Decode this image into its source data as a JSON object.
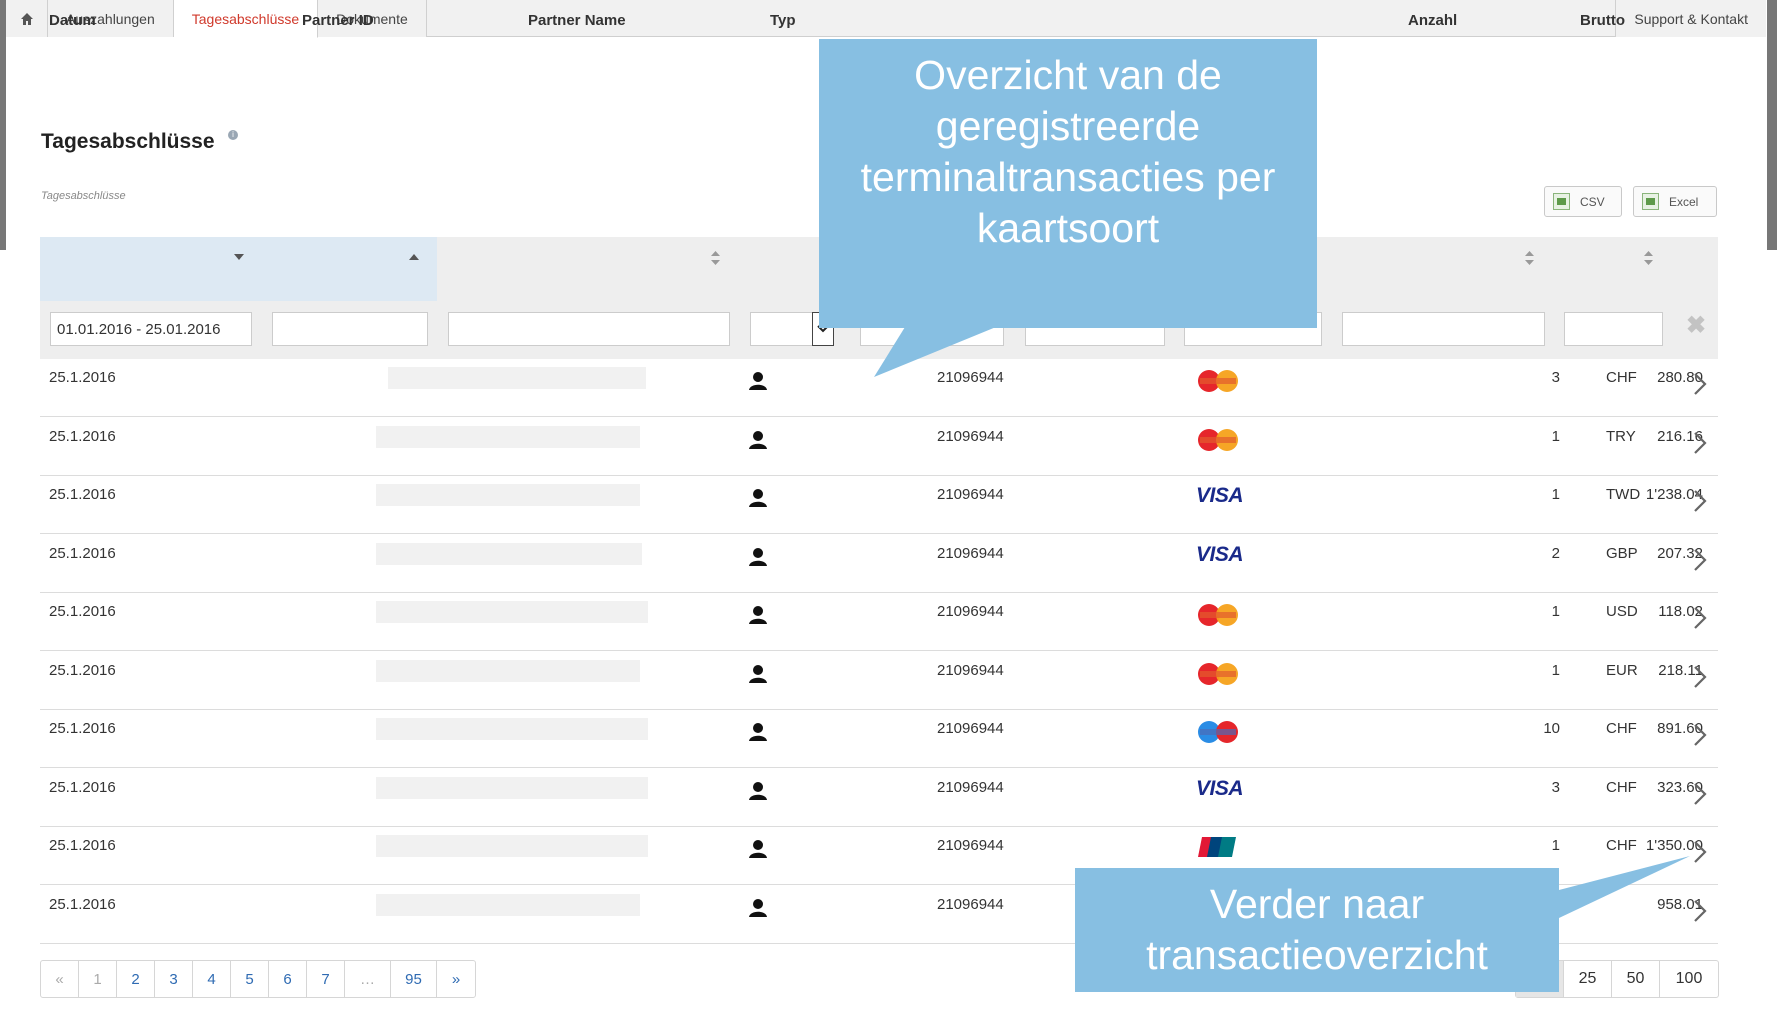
{
  "nav": {
    "home_icon": "home-icon",
    "tabs": [
      {
        "label": "Auszahlungen",
        "active": false
      },
      {
        "label": "Tagesabschlüsse",
        "active": true
      },
      {
        "label": "Dokumente",
        "active": false
      }
    ],
    "support": "Support & Kontakt"
  },
  "page": {
    "title": "Tagesabschlüsse",
    "info_icon": "info-icon",
    "subtitle": "Tagesabschlüsse"
  },
  "export": {
    "csv": "CSV",
    "excel": "Excel"
  },
  "table": {
    "headers": {
      "datum": "Datum",
      "partner_id": "Partner ID",
      "partner_name": "Partner Name",
      "typ": "Typ",
      "anzahl": "Anzahl",
      "brutto": "Brutto"
    },
    "filters": {
      "datum": "01.01.2016 - 25.01.2016"
    },
    "rows": [
      {
        "date": "25.1.2016",
        "terminal": "21096944",
        "card": "mastercard",
        "count": "3",
        "currency": "CHF",
        "amount": "280.80"
      },
      {
        "date": "25.1.2016",
        "terminal": "21096944",
        "card": "mastercard",
        "count": "1",
        "currency": "TRY",
        "amount": "216.16"
      },
      {
        "date": "25.1.2016",
        "terminal": "21096944",
        "card": "visa",
        "count": "1",
        "currency": "TWD",
        "amount": "1'238.04"
      },
      {
        "date": "25.1.2016",
        "terminal": "21096944",
        "card": "visa",
        "count": "2",
        "currency": "GBP",
        "amount": "207.32"
      },
      {
        "date": "25.1.2016",
        "terminal": "21096944",
        "card": "mastercard",
        "count": "1",
        "currency": "USD",
        "amount": "118.02"
      },
      {
        "date": "25.1.2016",
        "terminal": "21096944",
        "card": "mastercard",
        "count": "1",
        "currency": "EUR",
        "amount": "218.11"
      },
      {
        "date": "25.1.2016",
        "terminal": "21096944",
        "card": "maestro",
        "count": "10",
        "currency": "CHF",
        "amount": "891.60"
      },
      {
        "date": "25.1.2016",
        "terminal": "21096944",
        "card": "visa",
        "count": "3",
        "currency": "CHF",
        "amount": "323.60"
      },
      {
        "date": "25.1.2016",
        "terminal": "21096944",
        "card": "unionpay",
        "count": "1",
        "currency": "CHF",
        "amount": "1'350.00"
      },
      {
        "date": "25.1.2016",
        "terminal": "21096944",
        "card": "unknown",
        "count": "",
        "currency": "",
        "amount": "958.01"
      }
    ],
    "visa_text": "VISA"
  },
  "pagination": {
    "prev": "«",
    "pages": [
      "1",
      "2",
      "3",
      "4",
      "5",
      "6",
      "7",
      "…",
      "95"
    ],
    "next": "»",
    "sizes": [
      "",
      "25",
      "50",
      "100"
    ]
  },
  "callouts": {
    "top": "Overzicht van de geregistreerde terminaltransacties per kaartsoort",
    "bottom": "Verder naar transactieoverzicht"
  },
  "colors": {
    "callout": "#87bfe2",
    "active_tab": "#d0392b",
    "link": "#2f6bb3"
  }
}
